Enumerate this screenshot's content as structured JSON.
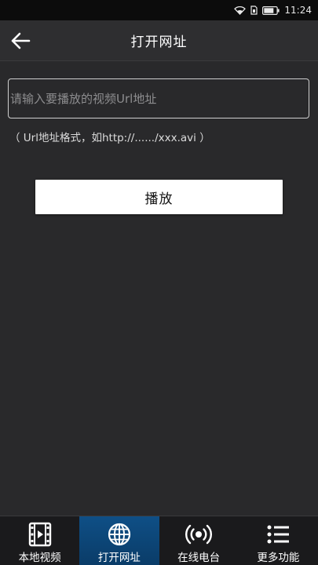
{
  "status_bar": {
    "time": "11:24"
  },
  "header": {
    "title": "打开网址"
  },
  "url_input": {
    "placeholder": "请输入要播放的视频Url地址",
    "value": ""
  },
  "hint": "（ Url地址格式，如http://....../xxx.avi ）",
  "play_button_label": "播放",
  "bottom_nav": {
    "items": [
      {
        "label": "本地视频",
        "icon": "film-icon",
        "active": false
      },
      {
        "label": "打开网址",
        "icon": "globe-icon",
        "active": true
      },
      {
        "label": "在线电台",
        "icon": "broadcast-icon",
        "active": false
      },
      {
        "label": "更多功能",
        "icon": "list-icon",
        "active": false
      }
    ]
  },
  "colors": {
    "background": "#29292b",
    "header": "#2e2e30",
    "status_bar": "#0c0c0c",
    "nav_bar": "#1a1a1c",
    "nav_active": "#0f4f86",
    "button": "#ffffff"
  }
}
